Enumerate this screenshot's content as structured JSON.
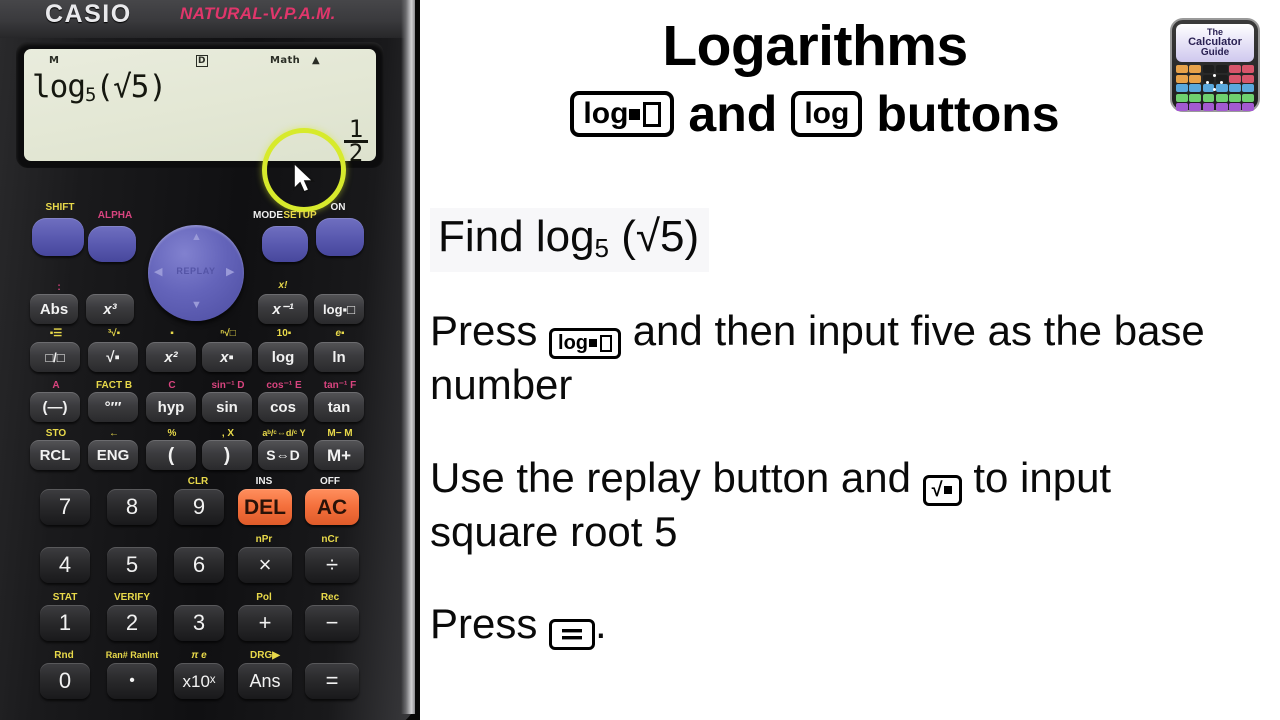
{
  "calculator": {
    "brand": "CASIO",
    "model_tagline": "NATURAL-V.P.A.M.",
    "display": {
      "indicator_memory": "M",
      "indicator_angle": "D",
      "indicator_math": "Math",
      "indicator_arrow": "▲",
      "expression_main": "log",
      "expression_base": "5",
      "expression_arg": "(√5)",
      "result_numerator": "1",
      "result_denominator": "2"
    },
    "top_keys": [
      {
        "label": "SHIFT",
        "color": "#e8d94a"
      },
      {
        "label": "ALPHA",
        "color": "#d9447f"
      },
      {
        "label": "REPLAY",
        "color": "#5454a6"
      },
      {
        "label": "MODE",
        "color": "#efefef"
      },
      {
        "label": "SETUP",
        "color": "#e8d94a"
      },
      {
        "label": "ON",
        "color": "#efefef"
      }
    ],
    "rows": [
      {
        "name": "row-abs",
        "keys": [
          {
            "label": "Abs",
            "sub": "",
            "sub_color": ""
          },
          {
            "label": "x³",
            "sub": ":",
            "sub_color": "c-p"
          },
          {
            "label": "x⁻¹",
            "sub": "x!",
            "sub_color": "c-y"
          },
          {
            "label": "log▪□",
            "sub": "",
            "sub_color": ""
          }
        ]
      },
      {
        "name": "row-func",
        "keys": [
          {
            "label": "□/□",
            "sub": "▪☰",
            "sub_color": "c-y"
          },
          {
            "label": "√▪",
            "sub": "³√▪",
            "sub_color": "c-y"
          },
          {
            "label": "x²",
            "sub": "▪",
            "sub_color": "c-y"
          },
          {
            "label": "x▪",
            "sub": "ⁿ√□",
            "sub_color": "c-y"
          },
          {
            "label": "log",
            "sub": "10▪",
            "sub_color": "c-y"
          },
          {
            "label": "ln",
            "sub": "e▪",
            "sub_color": "c-y"
          }
        ]
      },
      {
        "name": "row-trig",
        "keys": [
          {
            "label": "(—)",
            "sub": "A",
            "sub_color": "c-p"
          },
          {
            "label": "°′″",
            "sub": "FACT B",
            "sub_color": "c-y"
          },
          {
            "label": "hyp",
            "sub": "C",
            "sub_color": "c-p"
          },
          {
            "label": "sin",
            "sub": "sin⁻¹ D",
            "sub_color": "c-p"
          },
          {
            "label": "cos",
            "sub": "cos⁻¹ E",
            "sub_color": "c-p"
          },
          {
            "label": "tan",
            "sub": "tan⁻¹ F",
            "sub_color": "c-p"
          }
        ]
      },
      {
        "name": "row-memory",
        "keys": [
          {
            "label": "RCL",
            "sub": "STO",
            "sub_color": "c-y"
          },
          {
            "label": "ENG",
            "sub": "←",
            "sub_color": "c-y"
          },
          {
            "label": "(",
            "sub": "%",
            "sub_color": "c-y"
          },
          {
            "label": ")",
            "sub": ", X",
            "sub_color": "c-y"
          },
          {
            "label": "S⇔D",
            "sub": "aᵇ/ᶜ⇔d/ᶜ Y",
            "sub_color": "c-y"
          },
          {
            "label": "M+",
            "sub": "M− M",
            "sub_color": "c-y"
          }
        ]
      },
      {
        "name": "row-789",
        "keys": [
          {
            "label": "7",
            "sub": "",
            "sub_color": ""
          },
          {
            "label": "8",
            "sub": "",
            "sub_color": ""
          },
          {
            "label": "9",
            "sub": "CLR",
            "sub_color": "c-y"
          },
          {
            "label": "DEL",
            "sub": "INS",
            "sub_color": "c-w"
          },
          {
            "label": "AC",
            "sub": "OFF",
            "sub_color": "c-w"
          }
        ]
      },
      {
        "name": "row-456",
        "keys": [
          {
            "label": "4",
            "sub": "",
            "sub_color": ""
          },
          {
            "label": "5",
            "sub": "",
            "sub_color": ""
          },
          {
            "label": "6",
            "sub": "",
            "sub_color": ""
          },
          {
            "label": "×",
            "sub": "nPr",
            "sub_color": "c-y"
          },
          {
            "label": "÷",
            "sub": "nCr",
            "sub_color": "c-y"
          }
        ]
      },
      {
        "name": "row-123",
        "keys": [
          {
            "label": "1",
            "sub": "STAT",
            "sub_color": "c-y"
          },
          {
            "label": "2",
            "sub": "VERIFY",
            "sub_color": "c-y"
          },
          {
            "label": "3",
            "sub": "",
            "sub_color": ""
          },
          {
            "label": "+",
            "sub": "Pol",
            "sub_color": "c-y"
          },
          {
            "label": "−",
            "sub": "Rec",
            "sub_color": "c-y"
          }
        ]
      },
      {
        "name": "row-0",
        "keys": [
          {
            "label": "0",
            "sub": "Rnd",
            "sub_color": "c-y"
          },
          {
            "label": "•",
            "sub": "Ran# RanInt",
            "sub_color": "c-y"
          },
          {
            "label": "x10ˣ",
            "sub": "π    e",
            "sub_color": "c-y"
          },
          {
            "label": "Ans",
            "sub": "DRG▶",
            "sub_color": "c-y"
          },
          {
            "label": "=",
            "sub": "",
            "sub_color": ""
          }
        ]
      }
    ]
  },
  "slide": {
    "title": "Logarithms",
    "subtitle_and": "and",
    "subtitle_buttons": "buttons",
    "key_log_base": "log",
    "key_log": "log",
    "find_prefix": "Find log",
    "find_base": "5",
    "find_arg": "(√5)",
    "step1_a": "Press",
    "step1_b": "and then input five as the base number",
    "step2_a": "Use the replay button and",
    "step2_b": "to input square root 5",
    "step3_a": "Press",
    "step3_b": "."
  },
  "logo": {
    "line1": "The",
    "line2": "Calculator",
    "line3": "Guide",
    "grid_colors": [
      "#e8a24a",
      "#e8a24a",
      "#1d1d1d",
      "#1d1d1d",
      "#d8556b",
      "#d8556b",
      "#e8a24a",
      "#e8a24a",
      "#1d1d1d",
      "#1d1d1d",
      "#d8556b",
      "#d8556b",
      "#5aa8dd",
      "#5aa8dd",
      "#5aa8dd",
      "#5aa8dd",
      "#5aa8dd",
      "#5aa8dd",
      "#6fd06f",
      "#6fd06f",
      "#6fd06f",
      "#6fd06f",
      "#6fd06f",
      "#6fd06f",
      "#a35ad0",
      "#a35ad0",
      "#a35ad0",
      "#a35ad0",
      "#a35ad0",
      "#a35ad0"
    ]
  }
}
